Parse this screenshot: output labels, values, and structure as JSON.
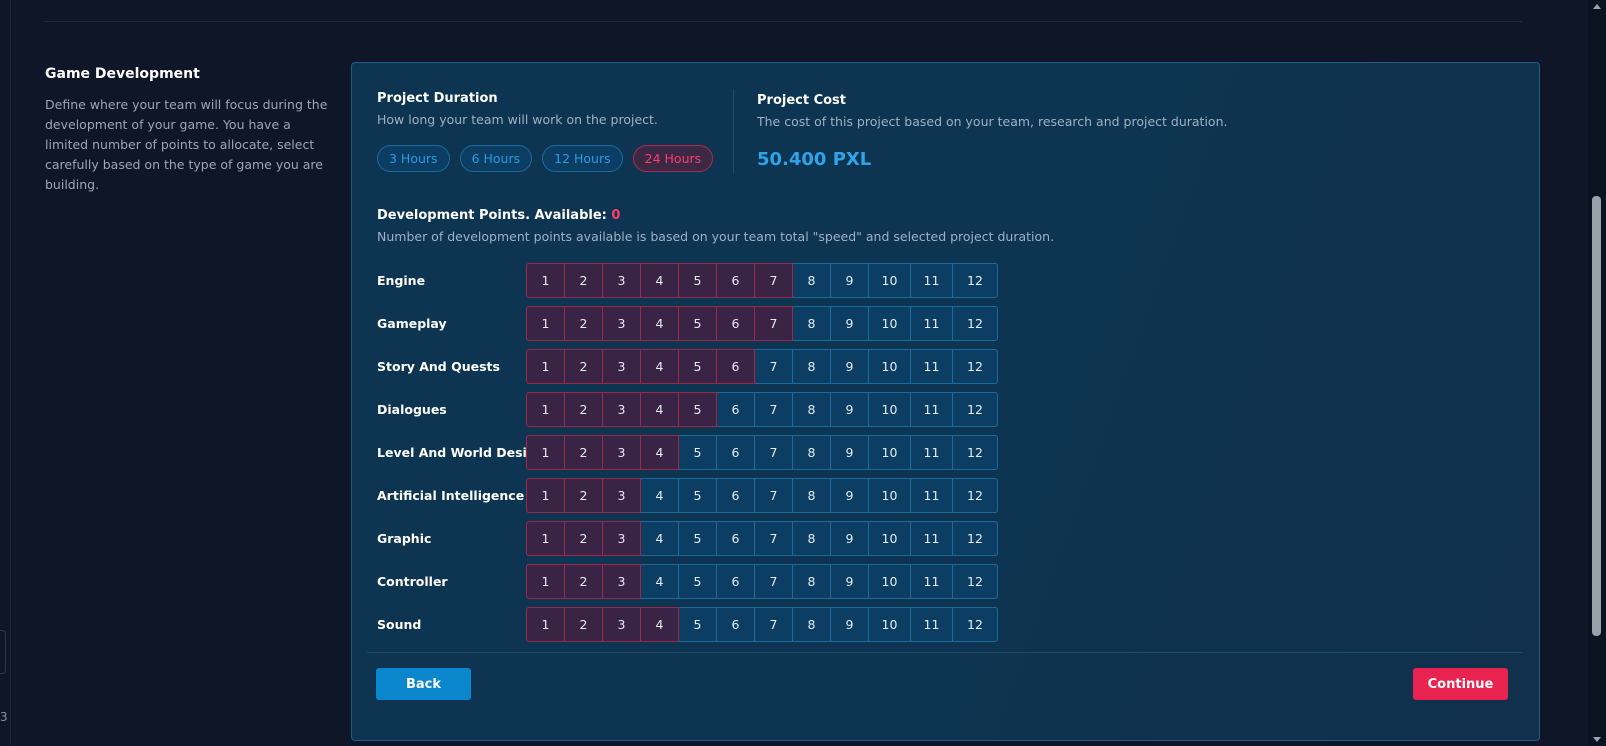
{
  "section": {
    "title": "Game Development",
    "description": "Define where your team will focus during the development of your game. You have a limited number of points to allocate, select carefully based on the type of game you are building."
  },
  "duration": {
    "label": "Project Duration",
    "sub": "How long your team will work on the project.",
    "options": [
      "3 Hours",
      "6 Hours",
      "12 Hours",
      "24 Hours"
    ],
    "selected": "24 Hours"
  },
  "cost": {
    "label": "Project Cost",
    "sub": "The cost of this project based on your team, research and project duration.",
    "value": "50.400 PXL"
  },
  "points": {
    "label_prefix": "Development Points. Available: ",
    "available": "0",
    "sub": "Number of development points available is based on your team total \"speed\" and selected project duration."
  },
  "levels": [
    "1",
    "2",
    "3",
    "4",
    "5",
    "6",
    "7",
    "8",
    "9",
    "10",
    "11",
    "12"
  ],
  "categories": [
    {
      "label": "Engine",
      "allocated": 7
    },
    {
      "label": "Gameplay",
      "allocated": 7
    },
    {
      "label": "Story And Quests",
      "allocated": 6
    },
    {
      "label": "Dialogues",
      "allocated": 5
    },
    {
      "label": "Level And World Design",
      "allocated": 4
    },
    {
      "label": "Artificial Intelligence",
      "allocated": 3
    },
    {
      "label": "Graphic",
      "allocated": 3
    },
    {
      "label": "Controller",
      "allocated": 3
    },
    {
      "label": "Sound",
      "allocated": 4
    }
  ],
  "actions": {
    "back": "Back",
    "continue": "Continue"
  },
  "edge_glyph": "3",
  "colors": {
    "background": "#0e1628",
    "panel": "#0d3451",
    "accent_blue": "#0a86cc",
    "accent_red": "#e8234f",
    "allocated_cell": "#3a2445"
  }
}
